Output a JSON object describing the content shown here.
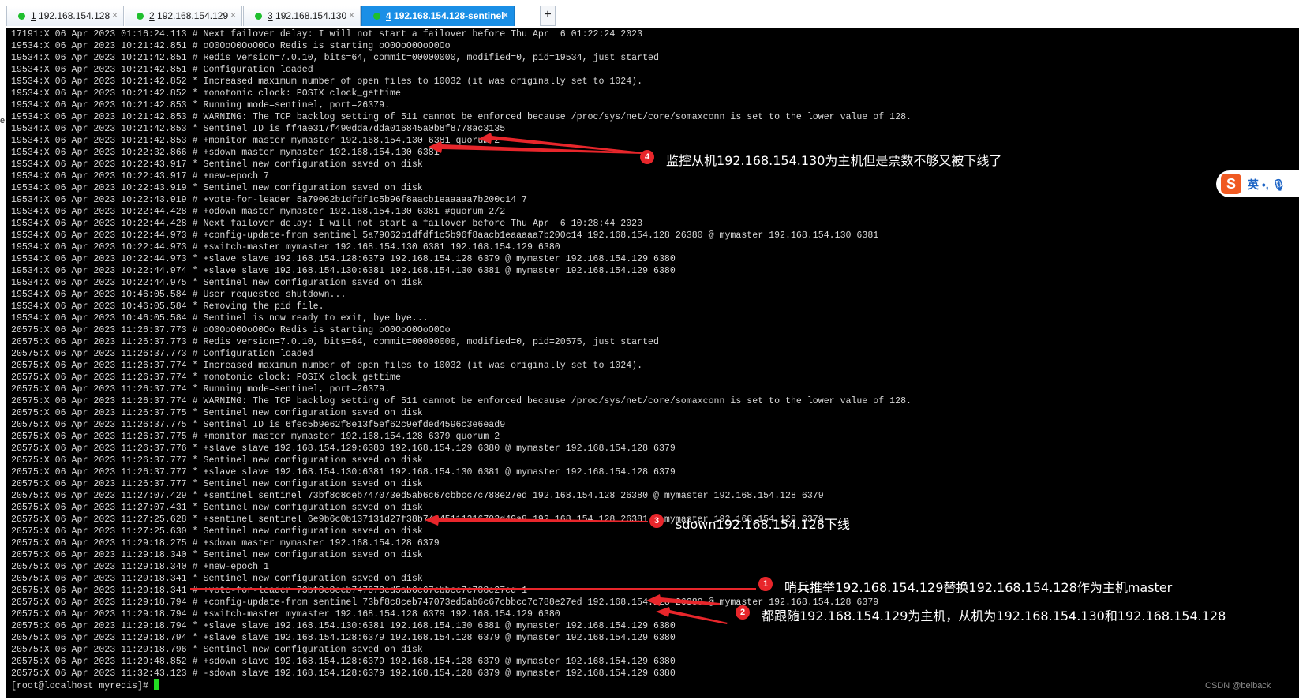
{
  "tabs": [
    {
      "num": "1",
      "host": "192.168.154.128",
      "dot": "#1fbf2e",
      "active": false
    },
    {
      "num": "2",
      "host": "192.168.154.129",
      "dot": "#1fbf2e",
      "active": false
    },
    {
      "num": "3",
      "host": "192.168.154.130",
      "dot": "#1fbf2e",
      "active": false
    },
    {
      "num": "4",
      "host": "192.168.154.128-sentinel",
      "dot": "#1fbf2e",
      "active": true
    }
  ],
  "new_tab_label": "+",
  "close_glyph": "×",
  "terminal": {
    "lines": [
      "17191:X 06 Apr 2023 01:16:24.113 # Next failover delay: I will not start a failover before Thu Apr  6 01:22:24 2023",
      "19534:X 06 Apr 2023 10:21:42.851 # oO0OoO0OoO0Oo Redis is starting oO0OoO0OoO0Oo",
      "19534:X 06 Apr 2023 10:21:42.851 # Redis version=7.0.10, bits=64, commit=00000000, modified=0, pid=19534, just started",
      "19534:X 06 Apr 2023 10:21:42.851 # Configuration loaded",
      "19534:X 06 Apr 2023 10:21:42.852 * Increased maximum number of open files to 10032 (it was originally set to 1024).",
      "19534:X 06 Apr 2023 10:21:42.852 * monotonic clock: POSIX clock_gettime",
      "19534:X 06 Apr 2023 10:21:42.853 * Running mode=sentinel, port=26379.",
      "19534:X 06 Apr 2023 10:21:42.853 # WARNING: The TCP backlog setting of 511 cannot be enforced because /proc/sys/net/core/somaxconn is set to the lower value of 128.",
      "19534:X 06 Apr 2023 10:21:42.853 * Sentinel ID is ff4ae317f490dda7dda016845a0b8f8778ac3135",
      "19534:X 06 Apr 2023 10:21:42.853 # +monitor master mymaster 192.168.154.130 6381 quorum 2",
      "19534:X 06 Apr 2023 10:22:32.866 # +sdown master mymaster 192.168.154.130 6381",
      "19534:X 06 Apr 2023 10:22:43.917 * Sentinel new configuration saved on disk",
      "19534:X 06 Apr 2023 10:22:43.917 # +new-epoch 7",
      "19534:X 06 Apr 2023 10:22:43.919 * Sentinel new configuration saved on disk",
      "19534:X 06 Apr 2023 10:22:43.919 # +vote-for-leader 5a79062b1dfdf1c5b96f8aacb1eaaaaa7b200c14 7",
      "19534:X 06 Apr 2023 10:22:44.428 # +odown master mymaster 192.168.154.130 6381 #quorum 2/2",
      "19534:X 06 Apr 2023 10:22:44.428 # Next failover delay: I will not start a failover before Thu Apr  6 10:28:44 2023",
      "19534:X 06 Apr 2023 10:22:44.973 # +config-update-from sentinel 5a79062b1dfdf1c5b96f8aacb1eaaaaa7b200c14 192.168.154.128 26380 @ mymaster 192.168.154.130 6381",
      "19534:X 06 Apr 2023 10:22:44.973 # +switch-master mymaster 192.168.154.130 6381 192.168.154.129 6380",
      "19534:X 06 Apr 2023 10:22:44.973 * +slave slave 192.168.154.128:6379 192.168.154.128 6379 @ mymaster 192.168.154.129 6380",
      "19534:X 06 Apr 2023 10:22:44.974 * +slave slave 192.168.154.130:6381 192.168.154.130 6381 @ mymaster 192.168.154.129 6380",
      "19534:X 06 Apr 2023 10:22:44.975 * Sentinel new configuration saved on disk",
      "19534:X 06 Apr 2023 10:46:05.584 # User requested shutdown...",
      "19534:X 06 Apr 2023 10:46:05.584 * Removing the pid file.",
      "19534:X 06 Apr 2023 10:46:05.584 # Sentinel is now ready to exit, bye bye...",
      "20575:X 06 Apr 2023 11:26:37.773 # oO0OoO0OoO0Oo Redis is starting oO0OoO0OoO0Oo",
      "20575:X 06 Apr 2023 11:26:37.773 # Redis version=7.0.10, bits=64, commit=00000000, modified=0, pid=20575, just started",
      "20575:X 06 Apr 2023 11:26:37.773 # Configuration loaded",
      "20575:X 06 Apr 2023 11:26:37.774 * Increased maximum number of open files to 10032 (it was originally set to 1024).",
      "20575:X 06 Apr 2023 11:26:37.774 * monotonic clock: POSIX clock_gettime",
      "20575:X 06 Apr 2023 11:26:37.774 * Running mode=sentinel, port=26379.",
      "20575:X 06 Apr 2023 11:26:37.774 # WARNING: The TCP backlog setting of 511 cannot be enforced because /proc/sys/net/core/somaxconn is set to the lower value of 128.",
      "20575:X 06 Apr 2023 11:26:37.775 * Sentinel new configuration saved on disk",
      "20575:X 06 Apr 2023 11:26:37.775 * Sentinel ID is 6fec5b9e62f8e13f5ef62c9efded4596c3e6ead9",
      "20575:X 06 Apr 2023 11:26:37.775 # +monitor master mymaster 192.168.154.128 6379 quorum 2",
      "20575:X 06 Apr 2023 11:26:37.776 * +slave slave 192.168.154.129:6380 192.168.154.129 6380 @ mymaster 192.168.154.128 6379",
      "20575:X 06 Apr 2023 11:26:37.777 * Sentinel new configuration saved on disk",
      "20575:X 06 Apr 2023 11:26:37.777 * +slave slave 192.168.154.130:6381 192.168.154.130 6381 @ mymaster 192.168.154.128 6379",
      "20575:X 06 Apr 2023 11:26:37.777 * Sentinel new configuration saved on disk",
      "20575:X 06 Apr 2023 11:27:07.429 * +sentinel sentinel 73bf8c8ceb747073ed5ab6c67cbbcc7c788e27ed 192.168.154.128 26380 @ mymaster 192.168.154.128 6379",
      "20575:X 06 Apr 2023 11:27:07.431 * Sentinel new configuration saved on disk",
      "20575:X 06 Apr 2023 11:27:25.628 * +sentinel sentinel 6e9b6c0b137131d27f38b74245111216793d49a8 192.168.154.128 26381 @ mymaster 192.168.154.128 6379",
      "20575:X 06 Apr 2023 11:27:25.630 * Sentinel new configuration saved on disk",
      "20575:X 06 Apr 2023 11:29:18.275 # +sdown master mymaster 192.168.154.128 6379",
      "20575:X 06 Apr 2023 11:29:18.340 * Sentinel new configuration saved on disk",
      "20575:X 06 Apr 2023 11:29:18.340 # +new-epoch 1",
      "20575:X 06 Apr 2023 11:29:18.341 * Sentinel new configuration saved on disk",
      "20575:X 06 Apr 2023 11:29:18.341 # +vote-for-leader 73bf8c8ceb747073ed5ab6c67cbbcc7c788e27ed 1",
      "20575:X 06 Apr 2023 11:29:18.794 # +config-update-from sentinel 73bf8c8ceb747073ed5ab6c67cbbcc7c788e27ed 192.168.154.128 26380 @ mymaster 192.168.154.128 6379",
      "20575:X 06 Apr 2023 11:29:18.794 # +switch-master mymaster 192.168.154.128 6379 192.168.154.129 6380",
      "20575:X 06 Apr 2023 11:29:18.794 * +slave slave 192.168.154.130:6381 192.168.154.130 6381 @ mymaster 192.168.154.129 6380",
      "20575:X 06 Apr 2023 11:29:18.794 * +slave slave 192.168.154.128:6379 192.168.154.128 6379 @ mymaster 192.168.154.129 6380",
      "20575:X 06 Apr 2023 11:29:18.796 * Sentinel new configuration saved on disk",
      "20575:X 06 Apr 2023 11:29:48.852 # +sdown slave 192.168.154.128:6379 192.168.154.128 6379 @ mymaster 192.168.154.129 6380",
      "20575:X 06 Apr 2023 11:32:43.123 # -sdown slave 192.168.154.128:6379 192.168.154.128 6379 @ mymaster 192.168.154.129 6380"
    ],
    "prompt": "[root@localhost myredis]# "
  },
  "annotations": [
    {
      "num": "4",
      "text": "监控从机192.168.154.130为主机但是票数不够又被下线了"
    },
    {
      "num": "3",
      "text": "sdown192.168.154.128下线"
    },
    {
      "num": "1",
      "text": "哨兵推举192.168.154.129替换192.168.154.128作为主机master"
    },
    {
      "num": "2",
      "text": "都跟随192.168.154.129为主机，从机为192.168.154.130和192.168.154.128"
    }
  ],
  "annotation_color": "#e8262b",
  "ime": {
    "logo": "S",
    "text": "英 •, 🎙"
  },
  "left_edge_char": "e",
  "watermark": "CSDN @beiback"
}
